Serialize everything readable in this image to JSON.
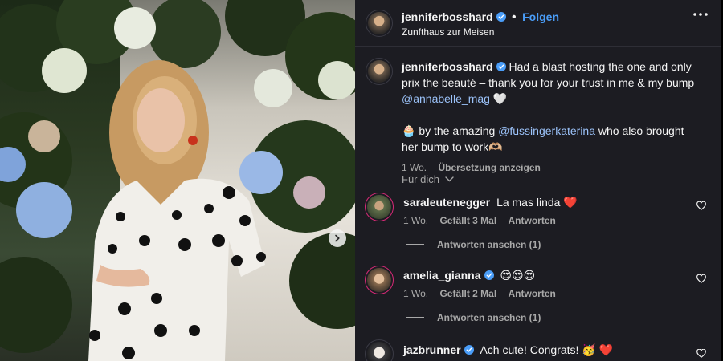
{
  "post": {
    "username": "jenniferbosshard",
    "follow_label": "Folgen",
    "location": "Zunfthaus zur Meisen",
    "verified": true
  },
  "caption": {
    "username": "jenniferbosshard",
    "text_1": "Had a blast hosting the one and only prix the beauté – thank you for your trust in me & my bump",
    "mention_1": "@annabelle_mag",
    "emoji_1": "🤍",
    "emoji_2": "🧁",
    "text_2": "by the amazing",
    "mention_2": "@fussingerkaterina",
    "text_3": "who also brought her bump to work🫶🏼",
    "time": "1 Wo.",
    "translate_label": "Übersetzung anzeigen"
  },
  "for_you_label": "Für dich",
  "comments": [
    {
      "username": "saraleutenegger",
      "verified": false,
      "text": "La mas linda ❤️",
      "time": "1 Wo.",
      "likes": "Gefällt 3 Mal",
      "reply_label": "Antworten",
      "view_replies": "Antworten ansehen (1)"
    },
    {
      "username": "amelia_gianna",
      "verified": true,
      "text": "😍😍😍",
      "time": "1 Wo.",
      "likes": "Gefällt 2 Mal",
      "reply_label": "Antworten",
      "view_replies": "Antworten ansehen (1)"
    },
    {
      "username": "jazbrunner",
      "verified": true,
      "text": "Ach cute! Congrats! 🥳 ❤️"
    }
  ],
  "colors": {
    "panel_bg": "#1c1c22",
    "link_blue": "#4a9df8",
    "mention_blue": "#9bc2f9",
    "muted": "#a8a8a8"
  },
  "icons": {
    "verified": "verified-badge-icon",
    "more": "more-options-icon",
    "heart": "heart-outline-icon",
    "chevron": "chevron-down-icon",
    "next": "chevron-right-icon"
  }
}
